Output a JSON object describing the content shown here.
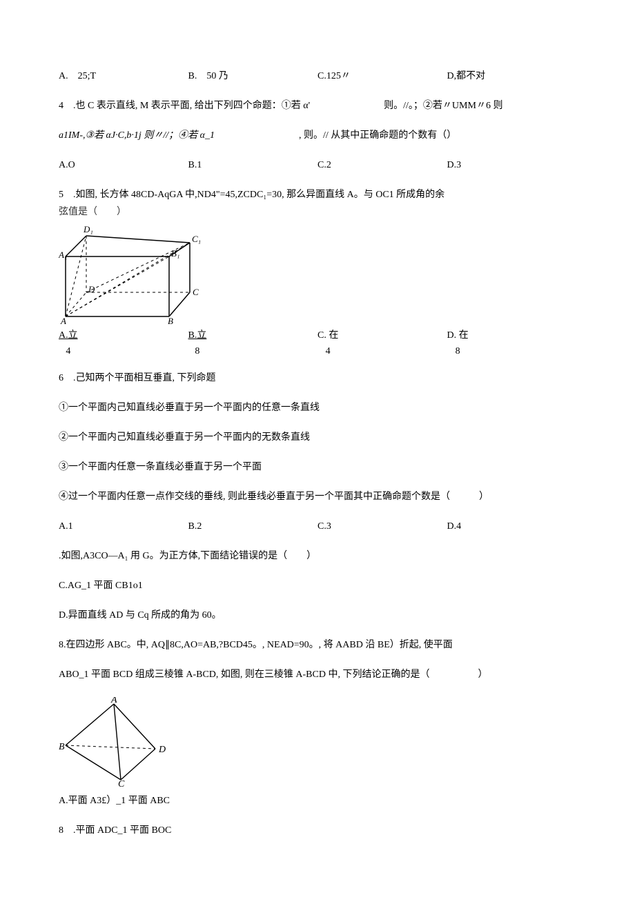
{
  "q3": {
    "opts": [
      "A.　25;T",
      "B.　50 乃",
      "C.125〃",
      "D,都不对"
    ]
  },
  "q4": {
    "line1_a": "4　.也 C 表示直线, M 表示平面, 给出下列四个命题：①若 α'",
    "line1_b": "则。//。；②若〃UMM〃6 则",
    "line2_a": "a1IM-,③若 αJ·C,b·1j 则〃//；④若 α_1",
    "line2_b": ", 则。// 从其中正确命题的个数有（）",
    "opts": [
      "A.O",
      "B.1",
      "C.2",
      "D.3"
    ]
  },
  "q5": {
    "line1": "5　.如图, 长方体 48CD-AqGA 中,ND4\"=45,ZCDC₁=30, 那么异面直线 A。与 OC1 所成角的余",
    "line2": "弦值是（　　）",
    "opts": [
      {
        "top": "A.立",
        "bot": "4"
      },
      {
        "top": "B.立",
        "bot": "8"
      },
      {
        "top": "C. 在",
        "bot": "4"
      },
      {
        "top": "D. 在",
        "bot": "8"
      }
    ]
  },
  "q6": {
    "line1": "6　.己知两个平面相互垂直, 下列命题",
    "p1": "①一个平面内己知直线必垂直于另一个平面内的任意一条直线",
    "p2": "②一个平面内己知直线必垂直于另一个平面内的无数条直线",
    "p3": "③一个平面内任意一条直线必垂直于另一个平面",
    "p4": "④过一个平面内任意一点作交线的垂线, 则此垂线必垂直于另一个平面其中正确命题个数是（　　　）",
    "opts": [
      "A.1",
      "B.2",
      "C.3",
      "D.4"
    ]
  },
  "q7": {
    "line1": ".如图,A3CO—A₁ 用 G。为正方体,下面结论错误的是（　　）",
    "c": "C.AG_1 平面 CB1o1",
    "d": "D.异面直线 AD 与 Cq 所成的角为 60。"
  },
  "q8": {
    "line1": "8.在四边形 ABC。中, AQ∥8C,AO=AB,?BCD45。, NEAD=90。, 将 AABD 沿 BE）折起, 使平面",
    "line2": "ABO_1 平面 BCD 组成三棱锥 A-BCD, 如图, 则在三棱锥 A-BCD 中, 下列结论正确的是（　　　　　）",
    "a": "A.平面 A3£）_1 平面 ABC",
    "b": "8　.平面 ADC_1 平面 BOC"
  }
}
